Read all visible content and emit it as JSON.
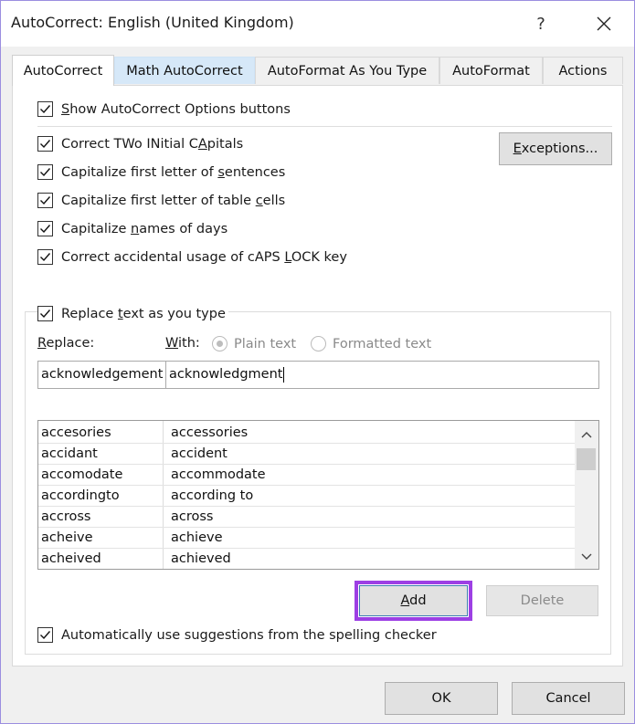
{
  "window": {
    "title": "AutoCorrect: English (United Kingdom)",
    "help_glyph": "?",
    "close_icon": "close-icon"
  },
  "tabs": [
    {
      "label": "AutoCorrect",
      "active": true
    },
    {
      "label": "Math AutoCorrect",
      "hover": true
    },
    {
      "label": "AutoFormat As You Type"
    },
    {
      "label": "AutoFormat"
    },
    {
      "label": "Actions"
    }
  ],
  "options": {
    "show_buttons": {
      "pre": "",
      "u": "S",
      "post": "how AutoCorrect Options buttons",
      "checked": true
    },
    "two_initials": {
      "pre": "Correct TWo INitial C",
      "u": "A",
      "post": "pitals",
      "checked": true
    },
    "sentences": {
      "pre": "Capitalize first letter of ",
      "u": "s",
      "post": "entences",
      "checked": true
    },
    "table_cells": {
      "pre": "Capitalize first letter of table ",
      "u": "c",
      "post": "ells",
      "checked": true
    },
    "days": {
      "pre": "Capitalize ",
      "u": "n",
      "post": "ames of days",
      "checked": true
    },
    "caps_lock": {
      "pre": "Correct accidental usage of cAPS ",
      "u": "L",
      "post": "OCK key",
      "checked": true
    }
  },
  "exceptions_button": {
    "u": "E",
    "post": "xceptions..."
  },
  "replace_section": {
    "replace_as_type": {
      "pre": "Replace ",
      "u": "t",
      "post": "ext as you type",
      "checked": true
    },
    "replace_label": {
      "u": "R",
      "post": "eplace:"
    },
    "with_label": {
      "u": "W",
      "post": "ith:"
    },
    "plain_text": "Plain text",
    "formatted_text": "Formatted text",
    "replace_value": "acknowledgement",
    "with_value": "acknowledgment"
  },
  "entries": [
    {
      "from": "accesories",
      "to": "accessories"
    },
    {
      "from": "accidant",
      "to": "accident"
    },
    {
      "from": "accomodate",
      "to": "accommodate"
    },
    {
      "from": "accordingto",
      "to": "according to"
    },
    {
      "from": "accross",
      "to": "across"
    },
    {
      "from": "acheive",
      "to": "achieve"
    },
    {
      "from": "acheived",
      "to": "achieved"
    }
  ],
  "add_button": {
    "u": "A",
    "post": "dd"
  },
  "delete_button": "Delete",
  "spelling_suggestions": {
    "pre": "Automatically use suggestions from the spelling checker",
    "checked": true
  },
  "footer": {
    "ok": "OK",
    "cancel": "Cancel"
  },
  "colors": {
    "focus_outline": "#9d3fe4",
    "tab_hover": "#d6e8f8",
    "frame": "#9b8ee0"
  }
}
